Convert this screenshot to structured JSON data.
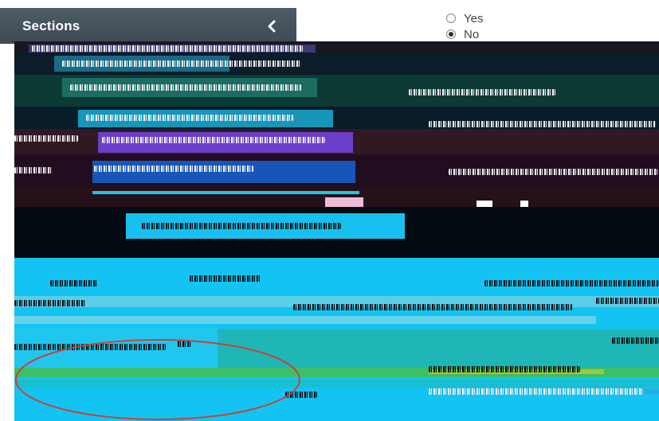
{
  "sidebar": {
    "title": "Sections",
    "collapse_icon": "chevron-left-icon"
  },
  "question": {
    "options": [
      {
        "label": "Yes",
        "selected": false
      },
      {
        "label": "No",
        "selected": true
      }
    ]
  },
  "colors": {
    "sidebar_bg": "#45525b",
    "accent_cyan": "#13c4f2",
    "highlight_circle": "#c4453c"
  }
}
